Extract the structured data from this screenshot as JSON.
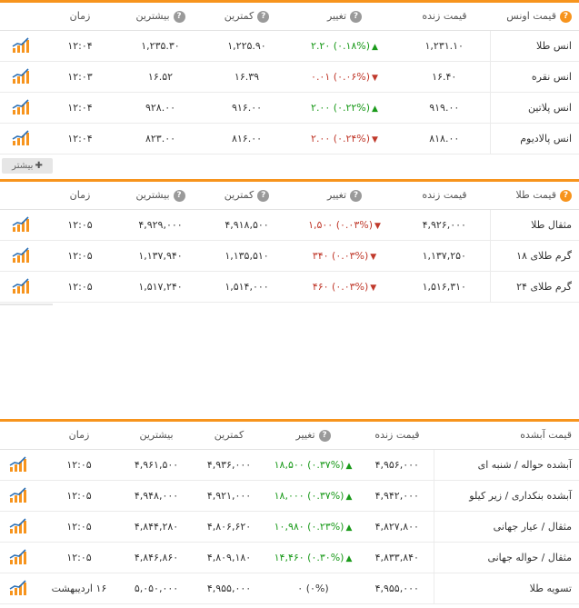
{
  "ounce": {
    "headers": {
      "name": "قیمت اونس",
      "live": "قیمت زنده",
      "change": "تغییر",
      "low": "کمترین",
      "high": "بیشترین",
      "time": "زمان"
    },
    "rows": [
      {
        "name": "انس طلا",
        "live": "۱,۲۳۱.۱۰",
        "pct": "(۰.۱۸%)",
        "chg": "۲.۲۰",
        "dir": "up",
        "low": "۱,۲۲۵.۹۰",
        "high": "۱,۲۳۵.۳۰",
        "time": "۱۲:۰۴"
      },
      {
        "name": "انس نقره",
        "live": "۱۶.۴۰",
        "pct": "(۰.۰۶%)",
        "chg": "۰.۰۱",
        "dir": "down",
        "low": "۱۶.۳۹",
        "high": "۱۶.۵۲",
        "time": "۱۲:۰۳"
      },
      {
        "name": "انس پلاتین",
        "live": "۹۱۹.۰۰",
        "pct": "(۰.۲۲%)",
        "chg": "۲.۰۰",
        "dir": "up",
        "low": "۹۱۶.۰۰",
        "high": "۹۲۸.۰۰",
        "time": "۱۲:۰۴"
      },
      {
        "name": "انس پالادیوم",
        "live": "۸۱۸.۰۰",
        "pct": "(۰.۲۴%)",
        "chg": "۲.۰۰",
        "dir": "down",
        "low": "۸۱۶.۰۰",
        "high": "۸۲۳.۰۰",
        "time": "۱۲:۰۴"
      }
    ],
    "more_label": "بیشتر"
  },
  "gold": {
    "headers": {
      "name": "قیمت طلا",
      "live": "قیمت زنده",
      "change": "تغییر",
      "low": "کمترین",
      "high": "بیشترین",
      "time": "زمان"
    },
    "rows": [
      {
        "name": "مثقال طلا",
        "live": "۴,۹۲۶,۰۰۰",
        "pct": "(۰.۰۳%)",
        "chg": "۱,۵۰۰",
        "dir": "down",
        "low": "۴,۹۱۸,۵۰۰",
        "high": "۴,۹۲۹,۰۰۰",
        "time": "۱۲:۰۵"
      },
      {
        "name": "گرم طلای ۱۸",
        "live": "۱,۱۳۷,۲۵۰",
        "pct": "(۰.۰۳%)",
        "chg": "۳۴۰",
        "dir": "down",
        "low": "۱,۱۳۵,۵۱۰",
        "high": "۱,۱۳۷,۹۴۰",
        "time": "۱۲:۰۵"
      },
      {
        "name": "گرم طلای ۲۴",
        "live": "۱,۵۱۶,۳۱۰",
        "pct": "(۰.۰۳%)",
        "chg": "۴۶۰",
        "dir": "down",
        "low": "۱,۵۱۴,۰۰۰",
        "high": "۱,۵۱۷,۲۴۰",
        "time": "۱۲:۰۵"
      }
    ]
  },
  "futures": {
    "headers": {
      "name": "قیمت آبشده",
      "live": "قیمت زنده",
      "change": "تغییر",
      "low": "کمترین",
      "high": "بیشترین",
      "time": "زمان"
    },
    "rows": [
      {
        "name": "آبشده حواله / شنبه ای",
        "live": "۴,۹۵۶,۰۰۰",
        "pct": "(۰.۳۷%)",
        "chg": "۱۸,۵۰۰",
        "dir": "up",
        "low": "۴,۹۳۶,۰۰۰",
        "high": "۴,۹۶۱,۵۰۰",
        "time": "۱۲:۰۵",
        "chart": true
      },
      {
        "name": "آبشده بنکداری / زیر کیلو",
        "live": "۴,۹۴۲,۰۰۰",
        "pct": "(۰.۳۷%)",
        "chg": "۱۸,۰۰۰",
        "dir": "up",
        "low": "۴,۹۲۱,۰۰۰",
        "high": "۴,۹۴۸,۰۰۰",
        "time": "۱۲:۰۵",
        "chart": true
      },
      {
        "name": "مثقال / عیار جهانی",
        "live": "۴,۸۲۷,۸۰۰",
        "pct": "(۰.۲۳%)",
        "chg": "۱۰,۹۸۰",
        "dir": "up",
        "low": "۴,۸۰۶,۶۲۰",
        "high": "۴,۸۴۴,۲۸۰",
        "time": "۱۲:۰۵",
        "chart": true
      },
      {
        "name": "مثقال / حواله جهانی",
        "live": "۴,۸۳۳,۸۴۰",
        "pct": "(۰.۳۰%)",
        "chg": "۱۴,۴۶۰",
        "dir": "up",
        "low": "۴,۸۰۹,۱۸۰",
        "high": "۴,۸۴۶,۸۶۰",
        "time": "۱۲:۰۵",
        "chart": true
      },
      {
        "name": "تسویه طلا",
        "live": "۴,۹۵۵,۰۰۰",
        "pct": "(۰%)",
        "chg": "۰",
        "dir": "none",
        "low": "۴,۹۵۵,۰۰۰",
        "high": "۵,۰۵۰,۰۰۰",
        "time": "۱۶ اردیبهشت",
        "chart": true
      }
    ]
  },
  "colors": {
    "accent": "#f7941d",
    "up": "#1a9a1a",
    "down": "#c0392b"
  },
  "icons": {
    "chart": "bar-chart-icon",
    "help": "question-icon",
    "plus": "plus-icon"
  }
}
